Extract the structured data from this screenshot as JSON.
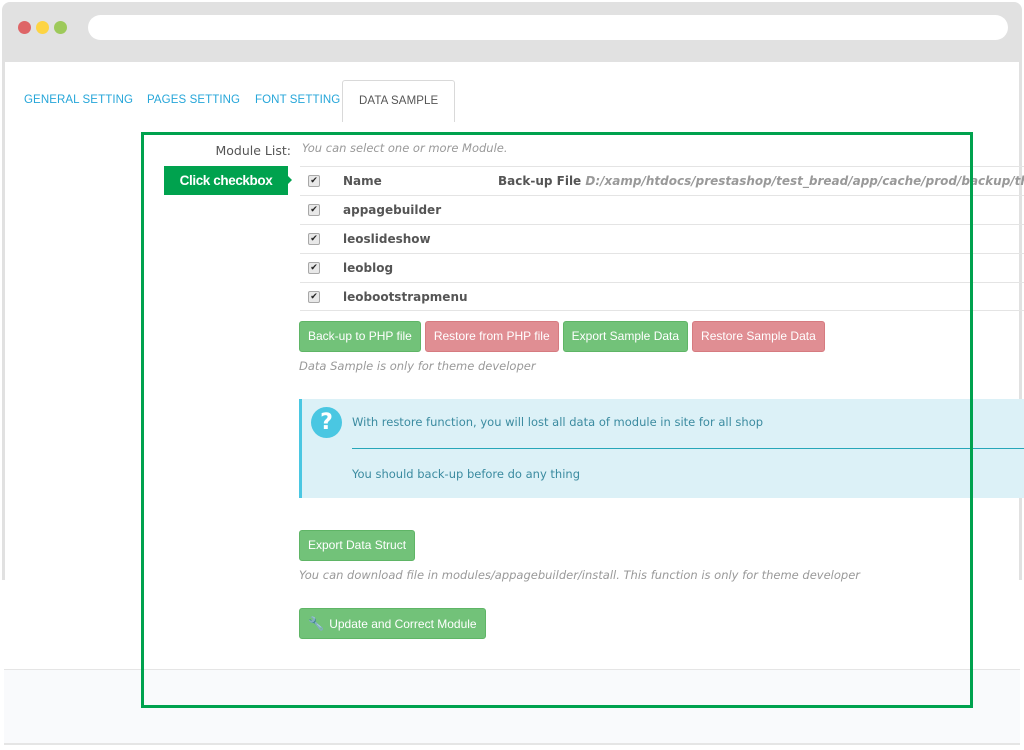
{
  "browser": {
    "window_controls": [
      "close",
      "minimize",
      "maximize"
    ],
    "url": ""
  },
  "tabs": [
    {
      "label": "GENERAL SETTING",
      "active": false
    },
    {
      "label": "PAGES SETTING",
      "active": false
    },
    {
      "label": "FONT SETTING",
      "active": false
    },
    {
      "label": "DATA SAMPLE",
      "active": true
    }
  ],
  "module_list": {
    "label": "Module List:",
    "hint": "You can select one or more Module.",
    "header": {
      "checked": true,
      "name": "Name",
      "backup_label": "Back-up File",
      "backup_path": "D:/xamp/htdocs/prestashop/test_bread/app/cache/prod/backup/themes/"
    },
    "modules": [
      {
        "name": "appagebuilder",
        "checked": true
      },
      {
        "name": "leoslideshow",
        "checked": true
      },
      {
        "name": "leoblog",
        "checked": true
      },
      {
        "name": "leobootstrapmenu",
        "checked": true
      }
    ]
  },
  "callout": {
    "text": "Click checkbox",
    "color": "#00a24e"
  },
  "actions": {
    "backup": "Back-up to PHP file",
    "restore_php": "Restore from PHP file",
    "export_sample": "Export Sample Data",
    "restore_sample": "Restore Sample Data",
    "hint": "Data Sample is only for theme developer"
  },
  "alert": {
    "icon": "question-circle-icon",
    "line1": "With restore function, you will lost all data of module in site for all shop",
    "line2": "You should back-up before do any thing"
  },
  "struct": {
    "button": "Export Data Struct",
    "hint": "You can download file in modules/appagebuilder/install. This function is only for theme developer"
  },
  "update": {
    "button": "Update and Correct Module",
    "icon": "wrench-icon"
  },
  "colors": {
    "success": "#72c279",
    "danger": "#e08e93",
    "info": "#4ac7e2",
    "tab_link": "#26a6d9",
    "highlight": "#00a24e"
  }
}
